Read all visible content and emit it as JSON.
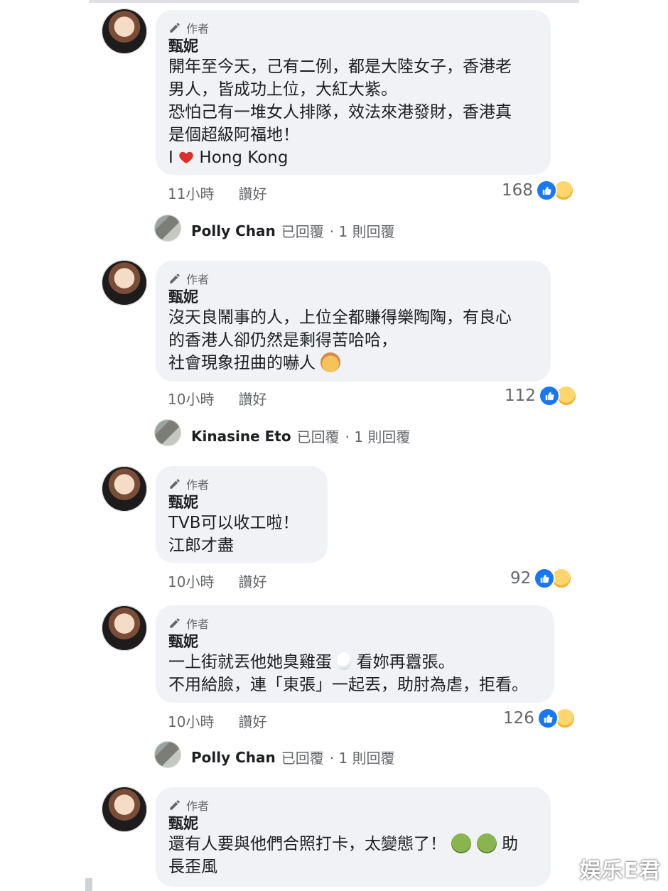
{
  "author_label": "作者",
  "comments": [
    {
      "name": "甄妮",
      "lines": [
        "開年至今天，己有二例，都是大陸女子，香港老",
        "男人，皆成功上位，大紅大紫。",
        "恐怕己有一堆女人排隊，效法來港發財，香港真",
        "是個超級阿福地！"
      ],
      "last_line": {
        "before": "I ",
        "after": "Hong Kong"
      },
      "time": "11小時",
      "like_label": "讚好",
      "reaction_count": "168"
    },
    {
      "name": "甄妮",
      "lines": [
        "沒天良鬧事的人，上位全都賺得樂陶陶，有良心",
        "的香港人卻仍然是剩得苦哈哈，",
        "社會現象扭曲的嚇人"
      ],
      "time": "10小時",
      "like_label": "讚好",
      "reaction_count": "112"
    },
    {
      "name": "甄妮",
      "lines": [
        "TVB可以收工啦！",
        "江郎才盡"
      ],
      "time": "10小時",
      "like_label": "讚好",
      "reaction_count": "92"
    },
    {
      "name": "甄妮",
      "lines": [
        "一上街就丟他她臭雞蛋",
        "看妳再囂張。",
        "不用給臉，連「東張」一起丟，助肘為虐，拒看。"
      ],
      "time": "10小時",
      "like_label": "讚好",
      "reaction_count": "126"
    },
    {
      "name": "甄妮",
      "lines": [
        "還有人要與他們合照打卡，太變態了！",
        "助",
        "長歪風"
      ]
    }
  ],
  "replies": [
    {
      "name": "Polly Chan",
      "status": "已回覆",
      "count": "· 1 則回覆"
    },
    {
      "name": "Kinasine Eto",
      "status": "已回覆",
      "count": "· 1 則回覆"
    },
    {
      "name": "Polly Chan",
      "status": "已回覆",
      "count": "· 1 則回覆"
    }
  ],
  "watermark": "娱乐E君",
  "icons": {
    "author_badge": "pencil-icon",
    "like_reaction": "like-icon",
    "haha_reaction": "haha-icon",
    "sad_reaction": "sad-icon",
    "heart_emoji": "heart-icon",
    "exploding_head_emoji": "exploding-head-icon",
    "egg_emoji": "egg-icon",
    "nauseated_emoji": "nauseated-face-icon"
  }
}
